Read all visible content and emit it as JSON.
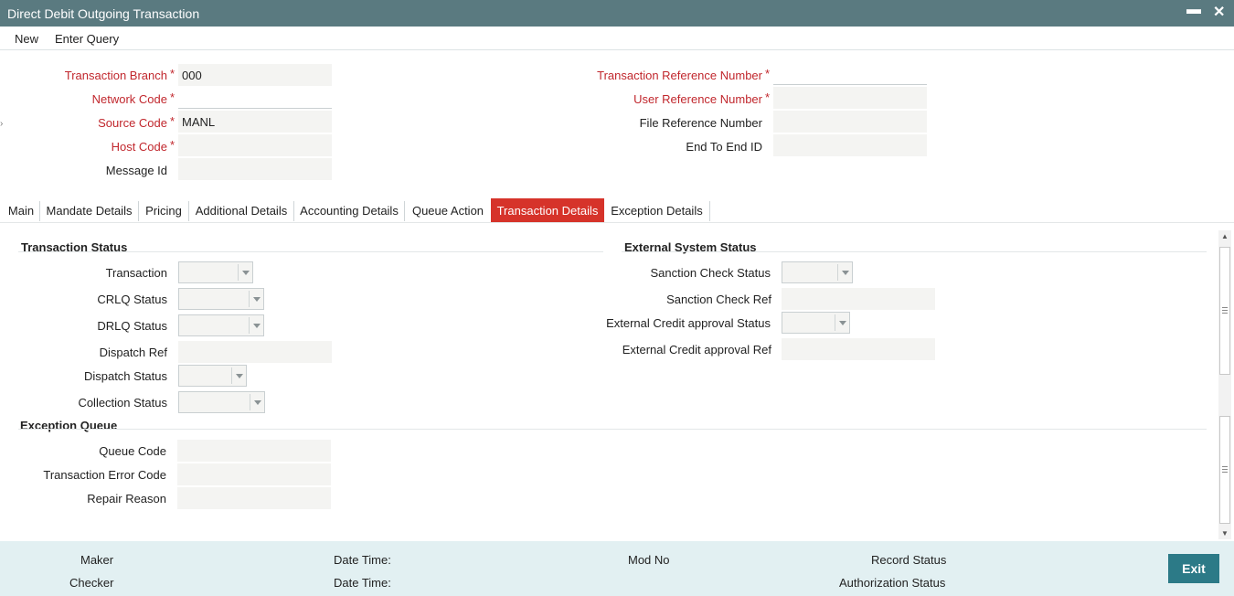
{
  "window": {
    "title": "Direct Debit Outgoing Transaction",
    "minimize_glyph": "▬",
    "close_glyph": "✕"
  },
  "menu": {
    "new": "New",
    "enter_query": "Enter Query"
  },
  "header": {
    "transaction_branch": {
      "label": "Transaction Branch",
      "value": "000"
    },
    "network_code": {
      "label": "Network Code",
      "value": ""
    },
    "source_code": {
      "label": "Source Code",
      "value": "MANL"
    },
    "host_code": {
      "label": "Host Code",
      "value": ""
    },
    "message_id": {
      "label": "Message Id",
      "value": ""
    },
    "transaction_reference_number": {
      "label": "Transaction Reference Number",
      "value": ""
    },
    "user_reference_number": {
      "label": "User Reference Number",
      "value": ""
    },
    "file_reference_number": {
      "label": "File Reference Number",
      "value": ""
    },
    "end_to_end_id": {
      "label": "End To End ID",
      "value": ""
    },
    "required_marker": "*"
  },
  "tabs": [
    "Main",
    "Mandate Details",
    "Pricing",
    "Additional Details",
    "Accounting Details",
    "Queue Action",
    "Transaction Details",
    "Exception Details"
  ],
  "active_tab": "Transaction Details",
  "transaction_status": {
    "heading": "Transaction Status",
    "transaction": "Transaction",
    "crlq_status": "CRLQ Status",
    "drlq_status": "DRLQ Status",
    "dispatch_ref": "Dispatch Ref",
    "dispatch_status": "Dispatch Status",
    "collection_status": "Collection Status"
  },
  "external_system_status": {
    "heading": "External System Status",
    "sanction_check_status": "Sanction Check Status",
    "sanction_check_ref": "Sanction Check Ref",
    "external_credit_approval_status": "External Credit approval Status",
    "external_credit_approval_ref": "External Credit approval Ref"
  },
  "exception_queue": {
    "heading": "Exception Queue",
    "queue_code": "Queue Code",
    "transaction_error_code": "Transaction Error Code",
    "repair_reason": "Repair Reason"
  },
  "footer": {
    "maker": "Maker",
    "checker": "Checker",
    "date_time_1": "Date Time:",
    "date_time_2": "Date Time:",
    "mod_no": "Mod No",
    "record_status": "Record Status",
    "authorization_status": "Authorization Status",
    "exit": "Exit"
  },
  "colors": {
    "titlebar": "#5a7a80",
    "active_tab": "#d6332a",
    "required_label": "#c1272d",
    "exit_button": "#2c7a87",
    "footer": "#e2f0f2"
  }
}
